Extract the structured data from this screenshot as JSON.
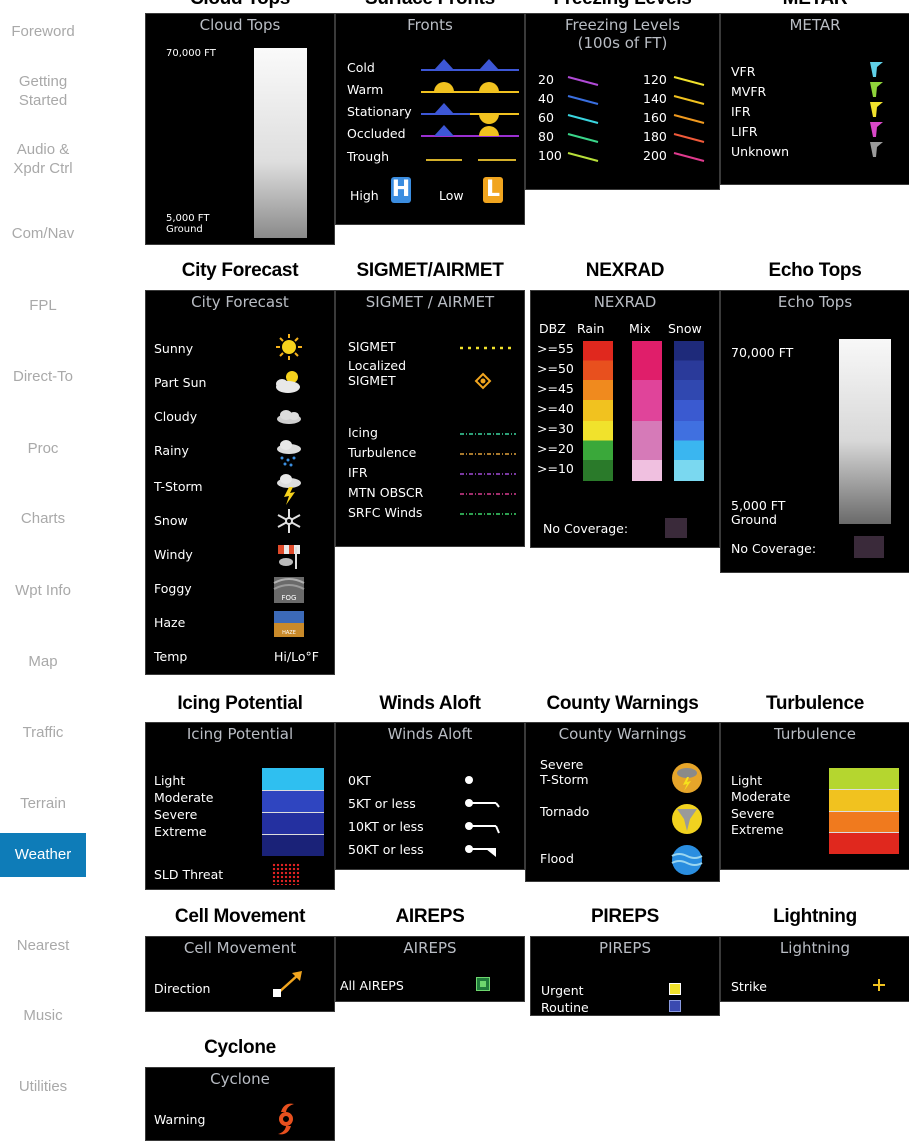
{
  "nav": {
    "items": [
      "Foreword",
      "Getting Started",
      "Audio & Xpdr Ctrl",
      "Com/Nav",
      "FPL",
      "Direct-To",
      "Proc",
      "Charts",
      "Wpt Info",
      "Map",
      "Traffic",
      "Terrain",
      "Weather",
      "Nearest",
      "Music",
      "Utilities"
    ],
    "active": "Weather",
    "active_color": "#0e7cb8"
  },
  "headers": {
    "cloud_tops": "Cloud Tops",
    "surface_fronts": "Surface Fronts",
    "freezing_levels": "Freezing Levels",
    "metar": "METAR",
    "city_forecast": "City Forecast",
    "sigmet_airmet": "SIGMET/AIRMET",
    "nexrad": "NEXRAD",
    "echo_tops": "Echo Tops",
    "icing_potential": "Icing Potential",
    "winds_aloft": "Winds Aloft",
    "county_warnings": "County Warnings",
    "turbulence": "Turbulence",
    "cell_movement": "Cell Movement",
    "aireps": "AIREPS",
    "pireps": "PIREPS",
    "lightning": "Lightning",
    "cyclone": "Cyclone"
  },
  "cloud_tops": {
    "title": "Cloud Tops",
    "top": "70,000 FT",
    "bottom_1": "5,000 FT",
    "bottom_2": "Ground"
  },
  "fronts": {
    "title": "Fronts",
    "items": [
      "Cold",
      "Warm",
      "Stationary",
      "Occluded",
      "Trough"
    ],
    "high": "High",
    "low": "Low"
  },
  "freezing": {
    "title_1": "Freezing Levels",
    "title_2": "(100s of FT)",
    "left": [
      "20",
      "40",
      "60",
      "80",
      "100"
    ],
    "right": [
      "120",
      "140",
      "160",
      "180",
      "200"
    ]
  },
  "metar": {
    "title": "METAR",
    "items": [
      "VFR",
      "MVFR",
      "IFR",
      "LIFR",
      "Unknown"
    ],
    "colors": [
      "#5fd0e8",
      "#8fd33a",
      "#f1e22c",
      "#d948c8",
      "#9a9a9a"
    ]
  },
  "city": {
    "title": "City Forecast",
    "items": [
      "Sunny",
      "Part Sun",
      "Cloudy",
      "Rainy",
      "T-Storm",
      "Snow",
      "Windy",
      "Foggy",
      "Haze",
      "Temp"
    ],
    "temp_value": "Hi/Lo°F",
    "fog_label": "FOG",
    "haze_label": "HAZE"
  },
  "sigmet": {
    "title": "SIGMET / AIRMET",
    "sigmet": "SIGMET",
    "localized_1": "Localized",
    "localized_2": "SIGMET",
    "items": [
      "Icing",
      "Turbulence",
      "IFR",
      "MTN OBSCR",
      "SRFC Winds"
    ]
  },
  "nexrad": {
    "title": "NEXRAD",
    "col_dbz": "DBZ",
    "col_rain": "Rain",
    "col_mix": "Mix",
    "col_snow": "Snow",
    "levels": [
      ">=55",
      ">=50",
      ">=45",
      ">=40",
      ">=30",
      ">=20",
      ">=10"
    ],
    "no_coverage": "No Coverage:"
  },
  "echo_tops": {
    "title": "Echo Tops",
    "top": "70,000 FT",
    "bottom_1": "5,000 FT",
    "bottom_2": "Ground",
    "no_coverage": "No Coverage:"
  },
  "icing": {
    "title": "Icing Potential",
    "items": [
      "Light",
      "Moderate",
      "Severe",
      "Extreme"
    ],
    "sld": "SLD Threat"
  },
  "winds": {
    "title": "Winds Aloft",
    "items": [
      "0KT",
      "5KT or less",
      "10KT or less",
      "50KT or less"
    ]
  },
  "county": {
    "title": "County Warnings",
    "severe_1": "Severe",
    "severe_2": "T-Storm",
    "tornado": "Tornado",
    "flood": "Flood"
  },
  "turbulence": {
    "title": "Turbulence",
    "items": [
      "Light",
      "Moderate",
      "Severe",
      "Extreme"
    ]
  },
  "cell": {
    "title": "Cell Movement",
    "label": "Direction"
  },
  "aireps": {
    "title": "AIREPS",
    "label": "All AIREPS"
  },
  "pireps": {
    "title": "PIREPS",
    "items": [
      "Urgent",
      "Routine"
    ]
  },
  "lightning": {
    "title": "Lightning",
    "label": "Strike"
  },
  "cyclone": {
    "title": "Cyclone",
    "label": "Warning"
  }
}
